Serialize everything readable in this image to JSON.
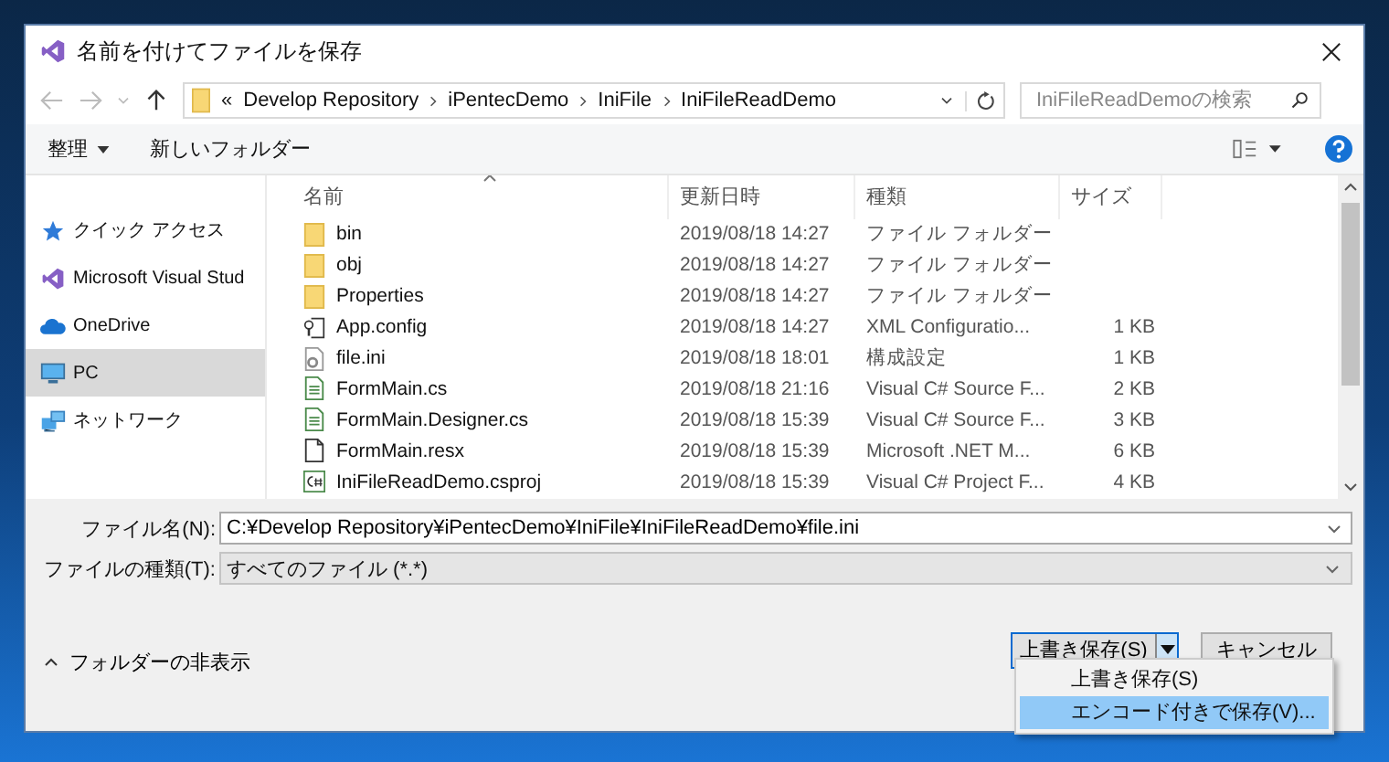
{
  "window": {
    "title": "名前を付けてファイルを保存"
  },
  "nav": {
    "overflow": "«",
    "path": [
      "Develop Repository",
      "iPentecDemo",
      "IniFile",
      "IniFileReadDemo"
    ],
    "search": {
      "placeholder": "IniFileReadDemoの検索"
    }
  },
  "toolbar": {
    "organize": "整理",
    "new_folder": "新しいフォルダー"
  },
  "sidebar": {
    "items": [
      {
        "label": "クイック アクセス",
        "kind": "star",
        "selected": false
      },
      {
        "label": "Microsoft Visual Stud",
        "kind": "vs",
        "selected": false
      },
      {
        "label": "OneDrive",
        "kind": "cloud",
        "selected": false
      },
      {
        "label": "PC",
        "kind": "pc",
        "selected": true
      },
      {
        "label": "ネットワーク",
        "kind": "network",
        "selected": false
      }
    ]
  },
  "table": {
    "columns": [
      "名前",
      "更新日時",
      "種類",
      "サイズ"
    ],
    "rows": [
      {
        "name": "bin",
        "date": "2019/08/18 14:27",
        "type": "ファイル フォルダー",
        "kind": "folder"
      },
      {
        "name": "obj",
        "date": "2019/08/18 14:27",
        "type": "ファイル フォルダー",
        "kind": "folder"
      },
      {
        "name": "Properties",
        "date": "2019/08/18 14:27",
        "type": "ファイル フォルダー",
        "kind": "folder"
      },
      {
        "name": "App.config",
        "date": "2019/08/18 14:27",
        "type": "XML Configuratio...",
        "size": "1 KB",
        "kind": "config"
      },
      {
        "name": "file.ini",
        "date": "2019/08/18 18:01",
        "type": "構成設定",
        "size": "1 KB",
        "kind": "settings"
      },
      {
        "name": "FormMain.cs",
        "date": "2019/08/18 21:16",
        "type": "Visual C# Source F...",
        "size": "2 KB",
        "kind": "source"
      },
      {
        "name": "FormMain.Designer.cs",
        "date": "2019/08/18 15:39",
        "type": "Visual C# Source F...",
        "size": "3 KB",
        "kind": "source"
      },
      {
        "name": "FormMain.resx",
        "date": "2019/08/18 15:39",
        "type": "Microsoft .NET M...",
        "size": "6 KB",
        "kind": "document"
      },
      {
        "name": "IniFileReadDemo.csproj",
        "date": "2019/08/18 15:39",
        "type": "Visual C# Project F...",
        "size": "4 KB",
        "kind": "project"
      }
    ]
  },
  "filename_field": {
    "label": "ファイル名(N):",
    "value": "C:¥Develop Repository¥iPentecDemo¥IniFile¥IniFileReadDemo¥file.ini"
  },
  "filetype_field": {
    "label": "ファイルの種類(T):",
    "value": "すべてのファイル (*.*)"
  },
  "hide_folders": "フォルダーの非表示",
  "buttons": {
    "save": "上書き保存(S)",
    "cancel": "キャンセル"
  },
  "save_menu": {
    "items": [
      {
        "label": "上書き保存(S)",
        "selected": false
      },
      {
        "label": "エンコード付きで保存(V)...",
        "selected": true
      }
    ]
  }
}
